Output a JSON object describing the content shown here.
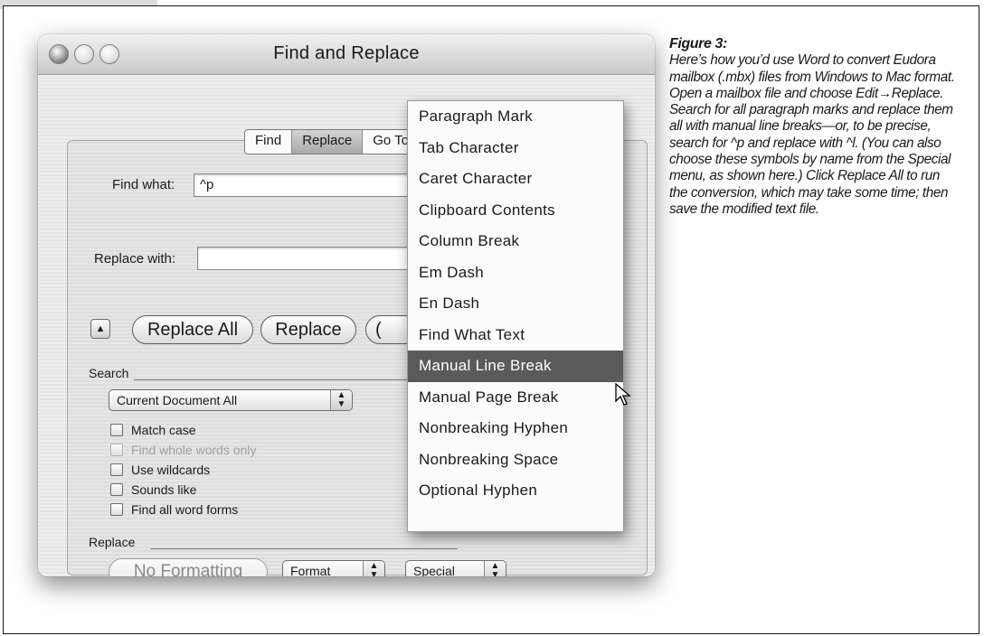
{
  "window": {
    "title": "Find and Replace"
  },
  "tabs": [
    {
      "label": "Find",
      "active": false
    },
    {
      "label": "Replace",
      "active": true
    },
    {
      "label": "Go To",
      "active": false
    }
  ],
  "find": {
    "label": "Find what:",
    "value": "^p"
  },
  "replace_field": {
    "label": "Replace with:",
    "value": ""
  },
  "buttons": {
    "replace_all": "Replace All",
    "replace": "Replace",
    "partial": "("
  },
  "search": {
    "heading": "Search",
    "scope": "Current Document All",
    "options": [
      {
        "label": "Match case",
        "enabled": true
      },
      {
        "label": "Find whole words only",
        "enabled": false
      },
      {
        "label": "Use wildcards",
        "enabled": true
      },
      {
        "label": "Sounds like",
        "enabled": true
      },
      {
        "label": "Find all word forms",
        "enabled": true
      }
    ]
  },
  "replace_section": {
    "heading": "Replace",
    "no_formatting": "No Formatting",
    "format": "Format",
    "special": "Special"
  },
  "special_menu": {
    "items": [
      "Paragraph Mark",
      "Tab Character",
      "Caret Character",
      "Clipboard Contents",
      "Column Break",
      "Em Dash",
      "En Dash",
      "Find What Text",
      "Manual Line Break",
      "Manual Page Break",
      "Nonbreaking Hyphen",
      "Nonbreaking Space",
      "Optional Hyphen"
    ],
    "selected": "Manual Line Break"
  },
  "caption": {
    "title": "Figure 3:",
    "body": "Here’s how you’d use Word to convert Eudora mailbox (.mbx) files from Windows to Mac format. Open a mailbox file and choose Edit→Replace. Search for all paragraph marks and replace them all with manual line breaks—or, to be precise, search for ^p and replace with ^l. (You can also choose these symbols by name from the Special menu, as shown here.) Click Replace All to run the conversion, which may take some time; then save the modified text file."
  },
  "colors": {
    "menu_highlight": "#5a5a5a",
    "window_bg": "#ececec"
  },
  "icons": {
    "close": "close-icon",
    "minimize": "minimize-icon",
    "zoom": "zoom-icon",
    "disclosure": "triangle-up-icon",
    "popup_arrows": "updown-arrows-icon",
    "cursor": "arrow-cursor-icon"
  }
}
